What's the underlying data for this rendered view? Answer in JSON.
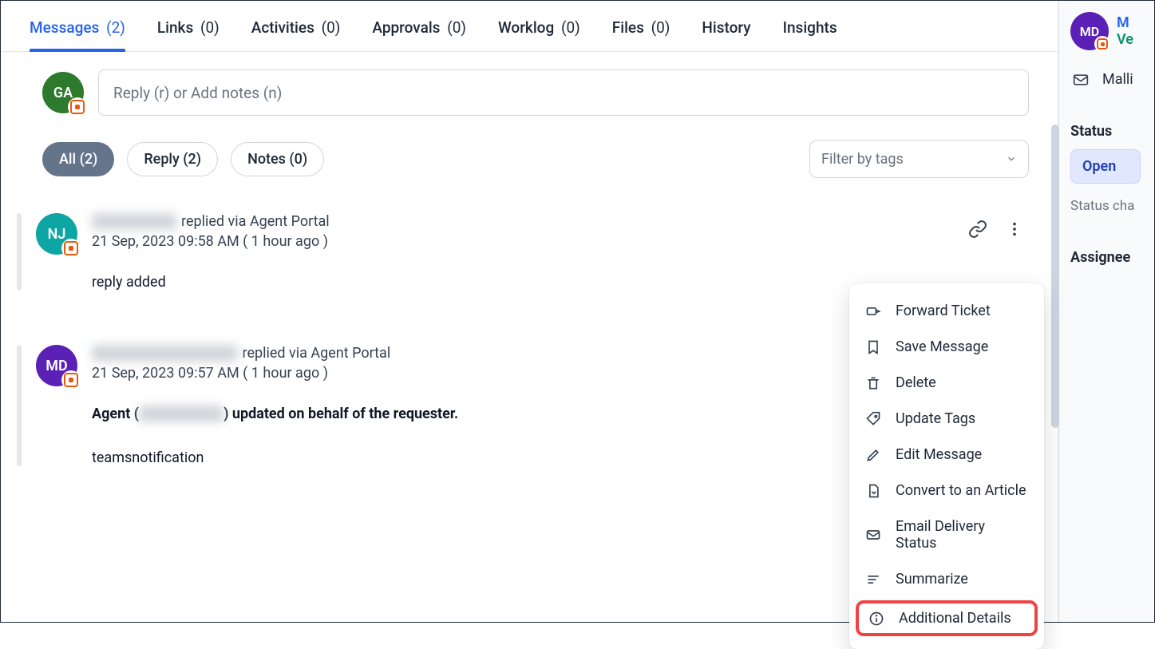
{
  "tabs": {
    "messages": {
      "label": "Messages",
      "count": "(2)"
    },
    "links": {
      "label": "Links",
      "count": "(0)"
    },
    "activities": {
      "label": "Activities",
      "count": "(0)"
    },
    "approvals": {
      "label": "Approvals",
      "count": "(0)"
    },
    "worklog": {
      "label": "Worklog",
      "count": "(0)"
    },
    "files": {
      "label": "Files",
      "count": "(0)"
    },
    "history": {
      "label": "History"
    },
    "insights": {
      "label": "Insights"
    }
  },
  "compose": {
    "avatar": "GA",
    "placeholder": "Reply (r) or Add notes (n)"
  },
  "filters": {
    "all": "All (2)",
    "reply": "Reply (2)",
    "notes": "Notes (0)",
    "tags_placeholder": "Filter by tags"
  },
  "messages": [
    {
      "avatar": "NJ",
      "avatar_class": "avatar-teal",
      "name_blur": "████████",
      "suffix": " replied via Agent Portal",
      "timestamp": "21 Sep, 2023 09:58 AM ( 1 hour ago )",
      "content_plain": "reply added",
      "show_more": true
    },
    {
      "avatar": "MD",
      "avatar_class": "avatar-purple",
      "name_blur": "██████████████",
      "suffix": " replied via Agent Portal",
      "timestamp": "21 Sep, 2023 09:57 AM ( 1 hour ago )",
      "content_bold_pre": "Agent (",
      "content_bold_blur": "████████",
      "content_bold_post": ") updated on behalf of the requester.",
      "content_plain_2": "teamsnotification",
      "show_more": false
    }
  ],
  "sidebar": {
    "avatar": "MD",
    "m": "M",
    "ve": "Ve",
    "email_name": "Malli",
    "status_label": "Status",
    "status_value": "Open",
    "status_sub": "Status cha",
    "assignee_label": "Assignee"
  },
  "dropdown": {
    "forward": "Forward Ticket",
    "save": "Save Message",
    "delete": "Delete",
    "tags": "Update Tags",
    "edit": "Edit Message",
    "convert": "Convert to an Article",
    "email_status": "Email Delivery Status",
    "summarize": "Summarize",
    "additional": "Additional Details"
  }
}
